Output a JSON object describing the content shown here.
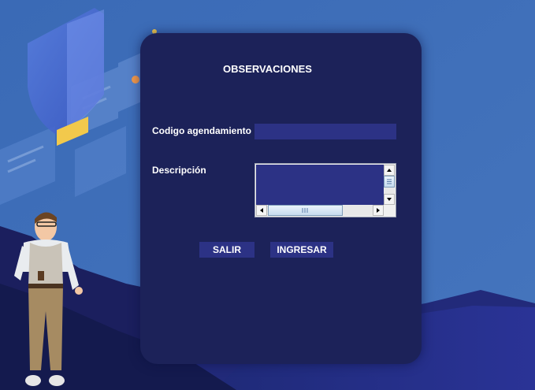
{
  "form": {
    "title": "OBSERVACIONES",
    "codigo_label": "Codigo agendamiento",
    "codigo_value": "",
    "descripcion_label": "Descripción",
    "descripcion_value": ""
  },
  "buttons": {
    "salir": "SALIR",
    "ingresar": "INGRESAR"
  },
  "colors": {
    "page_background": "#3f6fb8",
    "panel": "#1c2259",
    "field": "#2c3285",
    "text": "#ffffff"
  },
  "icons": [
    "scroll-up-arrow-icon",
    "scroll-down-arrow-icon",
    "scroll-left-arrow-icon",
    "scroll-right-arrow-icon"
  ]
}
